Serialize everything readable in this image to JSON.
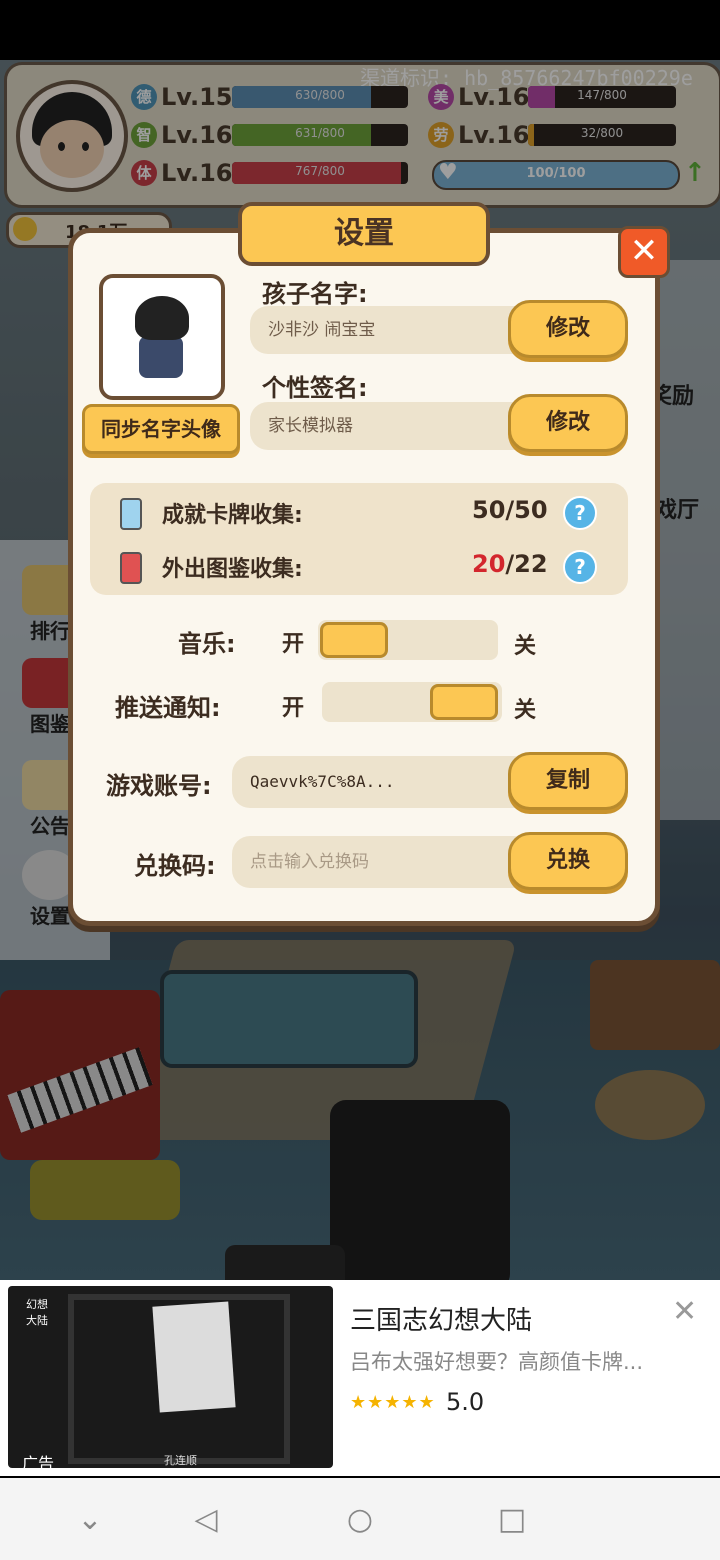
{
  "hud": {
    "channel": "渠道标识: hb_85766247bf00229e",
    "stats": [
      {
        "badge": "德",
        "level": "Lv.15",
        "bar": "630/800",
        "fill": 0.79,
        "color": "#5d8fb3"
      },
      {
        "badge": "智",
        "level": "Lv.16",
        "bar": "631/800",
        "fill": 0.79,
        "color": "#6ea33a"
      },
      {
        "badge": "体",
        "level": "Lv.16",
        "bar": "767/800",
        "fill": 0.96,
        "color": "#c9404a"
      },
      {
        "badge": "美",
        "level": "Lv.16",
        "bar": "147/800",
        "fill": 0.18,
        "color": "#b64aa8"
      },
      {
        "badge": "劳",
        "level": "Lv.16",
        "bar": "32/800",
        "fill": 0.04,
        "color": "#e0a22a"
      }
    ],
    "heart": "100/100",
    "coins": "18.1万"
  },
  "sidebar": {
    "items": [
      {
        "label": "排行"
      },
      {
        "label": "图鉴"
      },
      {
        "label": "公告"
      },
      {
        "label": "设置"
      }
    ],
    "right_labels": [
      "奖励",
      "戏厅"
    ]
  },
  "settings": {
    "title": "设置",
    "sync_button": "同步名字头像",
    "child_name_label": "孩子名字:",
    "child_name_value": "沙非沙 闹宝宝",
    "modify1": "修改",
    "signature_label": "个性签名:",
    "signature_value": "家长模拟器",
    "modify2": "修改",
    "collections": [
      {
        "label": "成就卡牌收集:",
        "current": "50",
        "total": "/50",
        "current_color": "#3c2c20"
      },
      {
        "label": "外出图鉴收集:",
        "current": "20",
        "total": "/22",
        "current_color": "#d3262d"
      }
    ],
    "help": "?",
    "music_label": "音乐:",
    "music_on": "开",
    "music_off": "关",
    "music_state": "on",
    "push_label": "推送通知:",
    "push_on": "开",
    "push_off": "关",
    "push_state": "off",
    "account_label": "游戏账号:",
    "account_value": "Qaevvk%7C%8A...",
    "copy_button": "复制",
    "code_label": "兑换码:",
    "code_placeholder": "点击输入兑换码",
    "exchange_button": "兑换",
    "close": "✕"
  },
  "ad": {
    "title": "三国志幻想大陆",
    "subtitle": "吕布太强好想要？高颜值卡牌...",
    "stars": "★★★★★",
    "rating": "5.0",
    "label": "广告",
    "brand": "孔连顺",
    "logo": "幻想大陆",
    "close": "✕"
  },
  "nav": {
    "back": "◁",
    "home": "○",
    "recent": "□",
    "down": "⌄"
  }
}
